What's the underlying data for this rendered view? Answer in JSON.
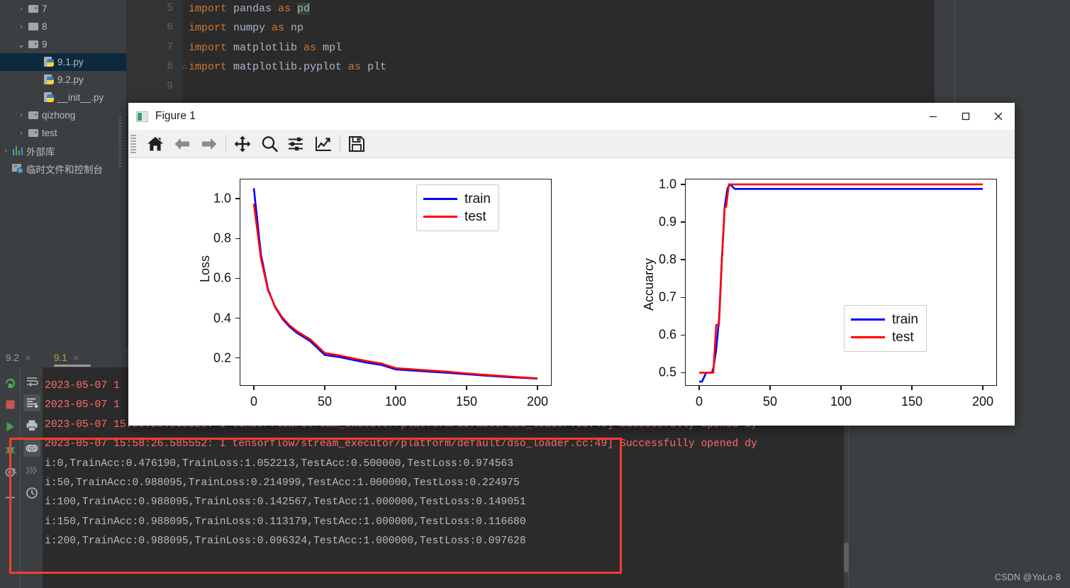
{
  "ide": {
    "project_tree": [
      {
        "label": "7",
        "indent": 1,
        "icon": "folder-dot-icon",
        "arrow": "collapsed",
        "selected": false
      },
      {
        "label": "8",
        "indent": 1,
        "icon": "folder-icon",
        "arrow": "collapsed",
        "selected": false
      },
      {
        "label": "9",
        "indent": 1,
        "icon": "folder-dot-icon",
        "arrow": "expanded",
        "selected": false
      },
      {
        "label": "9.1.py",
        "indent": 2,
        "icon": "python-file-icon",
        "arrow": "none",
        "selected": true
      },
      {
        "label": "9.2.py",
        "indent": 2,
        "icon": "python-file-icon",
        "arrow": "none",
        "selected": false
      },
      {
        "label": "__init__.py",
        "indent": 2,
        "icon": "python-file-icon",
        "arrow": "none",
        "selected": false
      },
      {
        "label": "qizhong",
        "indent": 1,
        "icon": "folder-dot-icon",
        "arrow": "collapsed",
        "selected": false
      },
      {
        "label": "test",
        "indent": 1,
        "icon": "folder-dot-icon",
        "arrow": "collapsed",
        "selected": false
      },
      {
        "label": "外部库",
        "indent": 0,
        "icon": "external-libraries-icon",
        "arrow": "collapsed",
        "selected": false
      },
      {
        "label": "临时文件和控制台",
        "indent": 0,
        "icon": "scratches-console-icon",
        "arrow": "none",
        "selected": false
      }
    ],
    "editor": {
      "line_numbers": [
        "5",
        "6",
        "7",
        "8",
        "9"
      ],
      "lines": [
        {
          "num": "5",
          "segments": [
            {
              "t": "import ",
              "c": "kw"
            },
            {
              "t": "pandas ",
              "c": "nm"
            },
            {
              "t": "as ",
              "c": "kw"
            },
            {
              "t": "pd",
              "c": "hl"
            }
          ]
        },
        {
          "num": "6",
          "segments": [
            {
              "t": "import ",
              "c": "kw"
            },
            {
              "t": "numpy ",
              "c": "nm"
            },
            {
              "t": "as ",
              "c": "kw"
            },
            {
              "t": "np",
              "c": "nm"
            }
          ]
        },
        {
          "num": "7",
          "segments": [
            {
              "t": "import ",
              "c": "kw"
            },
            {
              "t": "matplotlib ",
              "c": "nm"
            },
            {
              "t": "as ",
              "c": "kw"
            },
            {
              "t": "mpl",
              "c": "nm"
            }
          ]
        },
        {
          "num": "8",
          "segments": [
            {
              "t": "import ",
              "c": "kw"
            },
            {
              "t": "matplotlib.pyplot ",
              "c": "nm"
            },
            {
              "t": "as ",
              "c": "kw"
            },
            {
              "t": "plt",
              "c": "nm"
            }
          ]
        },
        {
          "num": "9",
          "segments": []
        }
      ]
    }
  },
  "console": {
    "tabs": [
      {
        "label": "9.2",
        "active": false,
        "close": "×"
      },
      {
        "label": "9.1",
        "active": true,
        "close": "×"
      }
    ],
    "run_gutter_icons": [
      "rerun-icon",
      "stop-icon",
      "run-icon",
      "debug-icon",
      "settings-icon",
      "add-icon"
    ],
    "toolbar_icons": [
      "soft-wrap-icon",
      "scroll-to-end-icon",
      "print-icon",
      "use-console-icon",
      "skip-breakpoints-icon",
      "history-icon"
    ],
    "lines": [
      {
        "text": "2023-05-07 15:58:25.865825: I tensorflow/stream_executor/platform/default/dso_loader.cc:49] Successfully opened dy",
        "type": "err"
      },
      {
        "text": "2023-05-07 15:58:26.585552: I tensorflow/stream_executor/platform/default/dso_loader.cc:49] Successfully opened dy",
        "type": "err"
      },
      {
        "text": "i:0,TrainAcc:0.476190,TrainLoss:1.052213,TestAcc:0.500000,TestLoss:0.974563",
        "type": "out"
      },
      {
        "text": "i:50,TrainAcc:0.988095,TrainLoss:0.214999,TestAcc:1.000000,TestLoss:0.224975",
        "type": "out"
      },
      {
        "text": "i:100,TrainAcc:0.988095,TrainLoss:0.142567,TestAcc:1.000000,TestLoss:0.149051",
        "type": "out"
      },
      {
        "text": "i:150,TrainAcc:0.988095,TrainLoss:0.113179,TestAcc:1.000000,TestLoss:0.116680",
        "type": "out"
      },
      {
        "text": "i:200,TrainAcc:0.988095,TrainLoss:0.096324,TestAcc:1.000000,TestLoss:0.097628",
        "type": "out"
      }
    ],
    "hidden_lines": [
      {
        "text": "2023-05-07 1",
        "type": "err"
      },
      {
        "text": "2023-05-07 1",
        "type": "err"
      }
    ]
  },
  "watermark": "CSDN @YoLo·8",
  "figure_window": {
    "title": "Figure 1",
    "window_buttons": [
      {
        "name": "minimize-button",
        "glyph": "minimize"
      },
      {
        "name": "maximize-button",
        "glyph": "maximize"
      },
      {
        "name": "close-button",
        "glyph": "close"
      }
    ],
    "toolbar": [
      {
        "name": "home-icon",
        "tooltip": "Home"
      },
      {
        "name": "back-arrow-icon",
        "tooltip": "Back"
      },
      {
        "name": "forward-arrow-icon",
        "tooltip": "Forward"
      },
      {
        "name": "pan-move-icon",
        "tooltip": "Pan"
      },
      {
        "name": "zoom-magnifier-icon",
        "tooltip": "Zoom"
      },
      {
        "name": "configure-subplots-icon",
        "tooltip": "Subplots"
      },
      {
        "name": "edit-axis-curve-icon",
        "tooltip": "Customize"
      },
      {
        "name": "save-figure-icon",
        "tooltip": "Save"
      }
    ]
  },
  "chart_data": [
    {
      "type": "line",
      "title": "",
      "xlabel": "",
      "ylabel": "Loss",
      "xlim": [
        -10,
        210
      ],
      "ylim": [
        0.06,
        1.1
      ],
      "xticks": [
        0,
        50,
        100,
        150,
        200
      ],
      "yticks": [
        0.2,
        0.4,
        0.6,
        0.8,
        1.0
      ],
      "grid": false,
      "legend_position": "upper right",
      "series": [
        {
          "name": "train",
          "color": "#0000ff",
          "x": [
            0,
            5,
            10,
            15,
            20,
            25,
            30,
            40,
            50,
            60,
            70,
            80,
            90,
            100,
            120,
            140,
            160,
            180,
            200
          ],
          "values": [
            1.052213,
            0.72,
            0.545,
            0.455,
            0.398,
            0.358,
            0.328,
            0.283,
            0.214999,
            0.205,
            0.19,
            0.176,
            0.165,
            0.142567,
            0.133,
            0.124,
            0.113179,
            0.104,
            0.096324
          ]
        },
        {
          "name": "test",
          "color": "#ff0000",
          "x": [
            0,
            5,
            10,
            15,
            20,
            25,
            30,
            40,
            50,
            60,
            70,
            80,
            90,
            100,
            120,
            140,
            160,
            180,
            200
          ],
          "values": [
            0.974563,
            0.7,
            0.54,
            0.458,
            0.404,
            0.365,
            0.336,
            0.292,
            0.224975,
            0.213,
            0.198,
            0.184,
            0.172,
            0.149051,
            0.139,
            0.129,
            0.11668,
            0.107,
            0.097628
          ]
        }
      ]
    },
    {
      "type": "line",
      "title": "",
      "xlabel": "",
      "ylabel": "Accuarcy",
      "xlim": [
        -10,
        210
      ],
      "ylim": [
        0.465,
        1.015
      ],
      "xticks": [
        0,
        50,
        100,
        150,
        200
      ],
      "yticks": [
        0.5,
        0.6,
        0.7,
        0.8,
        0.9,
        1.0
      ],
      "grid": false,
      "legend_position": "lower right",
      "series": [
        {
          "name": "train",
          "color": "#0000ff",
          "x": [
            0,
            2,
            5,
            9,
            10,
            12,
            14,
            16,
            18,
            20,
            22,
            25,
            50,
            100,
            150,
            200
          ],
          "values": [
            0.47619,
            0.47619,
            0.5,
            0.5,
            0.512,
            0.56,
            0.64,
            0.8,
            0.94,
            0.99,
            1.0,
            0.988095,
            0.988095,
            0.988095,
            0.988095,
            0.988095
          ]
        },
        {
          "name": "test",
          "color": "#ff0000",
          "x": [
            0,
            5,
            9,
            10,
            12,
            14,
            16,
            18,
            19,
            21,
            23,
            25,
            50,
            100,
            150,
            200
          ],
          "values": [
            0.5,
            0.5,
            0.5,
            0.5,
            0.627,
            0.627,
            0.8,
            0.94,
            0.94,
            1.0,
            1.0,
            1.0,
            1.0,
            1.0,
            1.0,
            1.0
          ]
        }
      ]
    }
  ]
}
